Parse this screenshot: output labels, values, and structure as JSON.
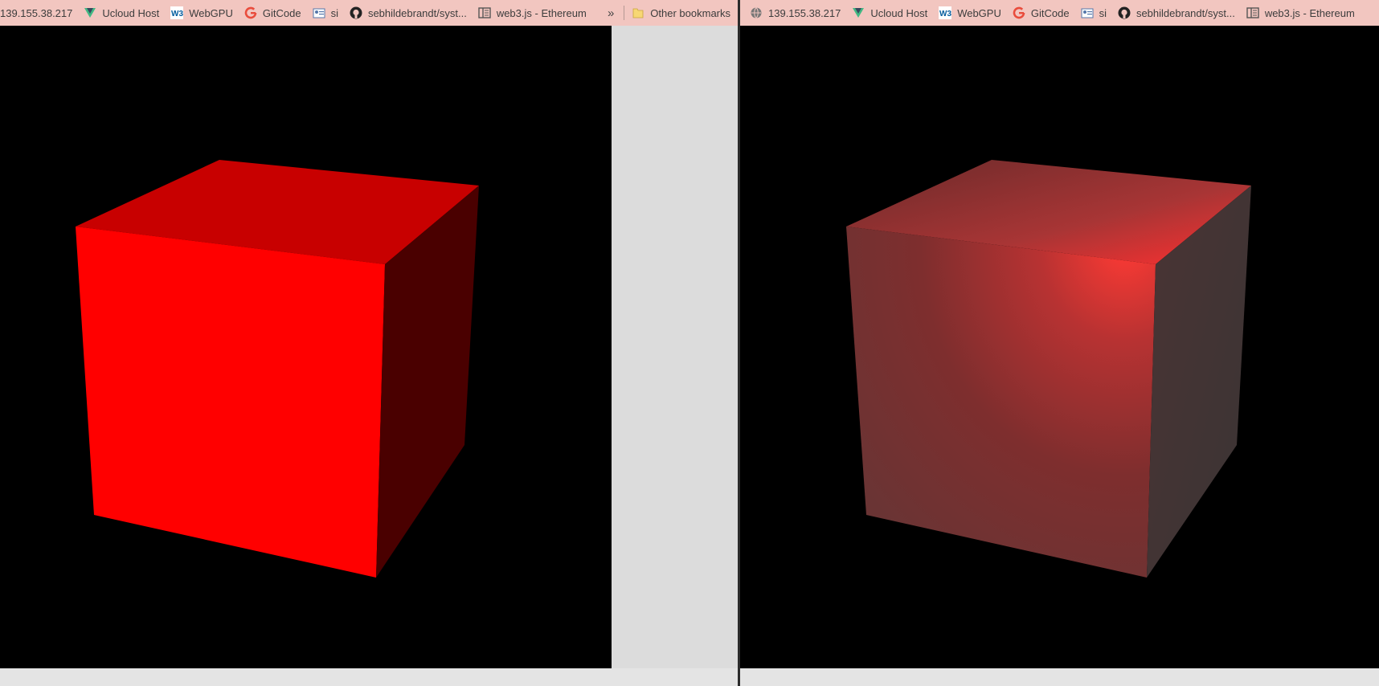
{
  "left_window": {
    "bookmarks": [
      {
        "label": "139.155.38.217",
        "icon": "none"
      },
      {
        "label": "Ucloud Host",
        "icon": "vue-icon"
      },
      {
        "label": "WebGPU",
        "icon": "w3c-icon"
      },
      {
        "label": "GitCode",
        "icon": "google-icon"
      },
      {
        "label": "si",
        "icon": "card-icon"
      },
      {
        "label": "sebhildebrandt/syst...",
        "icon": "github-icon"
      },
      {
        "label": "web3.js - Ethereum",
        "icon": "reader-icon"
      }
    ],
    "overflow_label": "»",
    "other_bookmarks": {
      "label": "Other bookmarks",
      "icon": "folder-icon"
    },
    "cube": {
      "shading": "flat",
      "front_color": "#ff0000",
      "top_color": "#c80000",
      "side_color": "#4a0000"
    }
  },
  "right_window": {
    "bookmarks": [
      {
        "label": "139.155.38.217",
        "icon": "globe-icon"
      },
      {
        "label": "Ucloud Host",
        "icon": "vue-icon"
      },
      {
        "label": "WebGPU",
        "icon": "w3c-icon"
      },
      {
        "label": "GitCode",
        "icon": "google-icon"
      },
      {
        "label": "si",
        "icon": "card-icon"
      },
      {
        "label": "sebhildebrandt/syst...",
        "icon": "github-icon"
      },
      {
        "label": "web3.js - Ethereum",
        "icon": "reader-icon"
      }
    ],
    "cube": {
      "shading": "lit",
      "front_color": "#7a3030",
      "top_color": "#a83535",
      "side_color": "#403535",
      "highlight_color": "#ff3030"
    }
  }
}
